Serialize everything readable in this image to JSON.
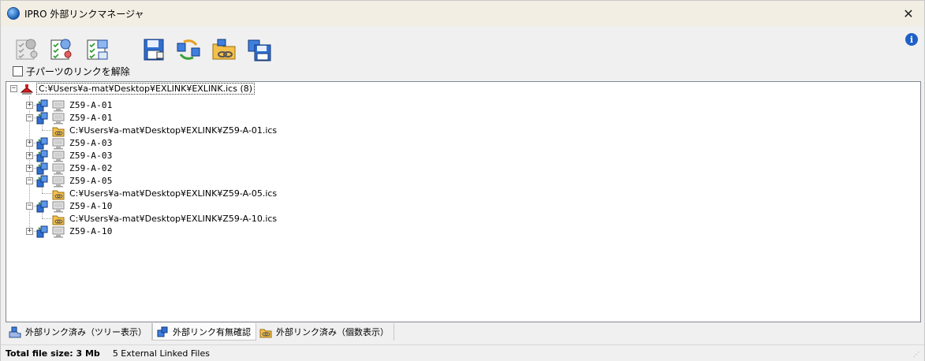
{
  "window": {
    "title": "IPRO 外部リンクマネージャ",
    "close_symbol": "✕"
  },
  "toolbar": {
    "buttons": [
      {
        "name": "check-links-disabled-icon"
      },
      {
        "name": "check-links-icon"
      },
      {
        "name": "check-list-icon"
      },
      {
        "name": "save-icon"
      },
      {
        "name": "relink-icon"
      },
      {
        "name": "open-folder-link-icon"
      },
      {
        "name": "save-copy-icon"
      }
    ],
    "info_symbol": "i",
    "unlink_children_label": "子パーツのリンクを解除"
  },
  "tree": {
    "root_label": "C:¥Users¥a-mat¥Desktop¥EXLINK¥EXLINK.ics (8)",
    "nodes": [
      {
        "label": "Z59-A-01",
        "expanded": false
      },
      {
        "label": "Z59-A-01",
        "expanded": true,
        "child": "C:¥Users¥a-mat¥Desktop¥EXLINK¥Z59-A-01.ics"
      },
      {
        "label": "Z59-A-03",
        "expanded": false
      },
      {
        "label": "Z59-A-03",
        "expanded": false
      },
      {
        "label": "Z59-A-02",
        "expanded": false
      },
      {
        "label": "Z59-A-05",
        "expanded": true,
        "child": "C:¥Users¥a-mat¥Desktop¥EXLINK¥Z59-A-05.ics"
      },
      {
        "label": "Z59-A-10",
        "expanded": true,
        "child": "C:¥Users¥a-mat¥Desktop¥EXLINK¥Z59-A-10.ics"
      },
      {
        "label": "Z59-A-10",
        "expanded": false
      }
    ],
    "expand_symbol": "+",
    "collapse_symbol": "−"
  },
  "tabs": [
    {
      "label": "外部リンク済み（ツリー表示）",
      "active": false
    },
    {
      "label": "外部リンク有無確認",
      "active": true
    },
    {
      "label": "外部リンク済み（個数表示）",
      "active": false
    }
  ],
  "status": {
    "size": "Total file size: 3 Mb",
    "count": "5 External Linked Files"
  },
  "colors": {
    "titlebar": "#f3eee3",
    "accent_blue": "#1f5fc8",
    "folder": "#f5c04a"
  }
}
